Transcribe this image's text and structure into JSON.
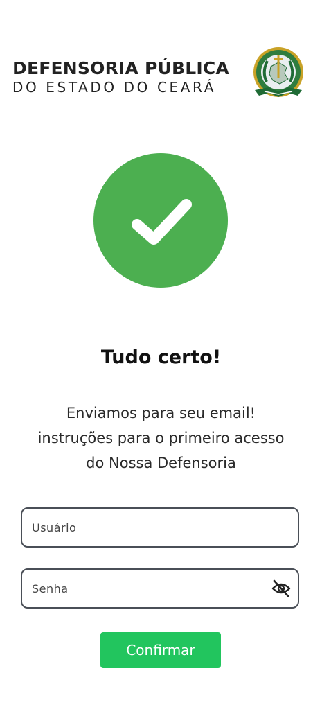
{
  "header": {
    "title": "DEFENSORIA PÚBLICA",
    "subtitle": "DO ESTADO DO CEARÁ",
    "seal_icon": "defensoria-seal-icon"
  },
  "status": {
    "icon": "check-icon",
    "color": "#4caf50",
    "heading": "Tudo certo!"
  },
  "message": {
    "line1": "Enviamos para seu email!",
    "line2": "instruções para o primeiro acesso",
    "line3": "do Nossa Defensoria"
  },
  "form": {
    "username": {
      "placeholder": "Usuário",
      "value": ""
    },
    "password": {
      "placeholder": "Senha",
      "value": "",
      "toggle_icon": "eye-off-icon"
    },
    "submit_label": "Confirmar"
  },
  "colors": {
    "accent": "#22c55e",
    "success": "#4caf50",
    "seal_green": "#1f6b35",
    "seal_gold": "#c9a227",
    "border": "#4a4f57"
  }
}
